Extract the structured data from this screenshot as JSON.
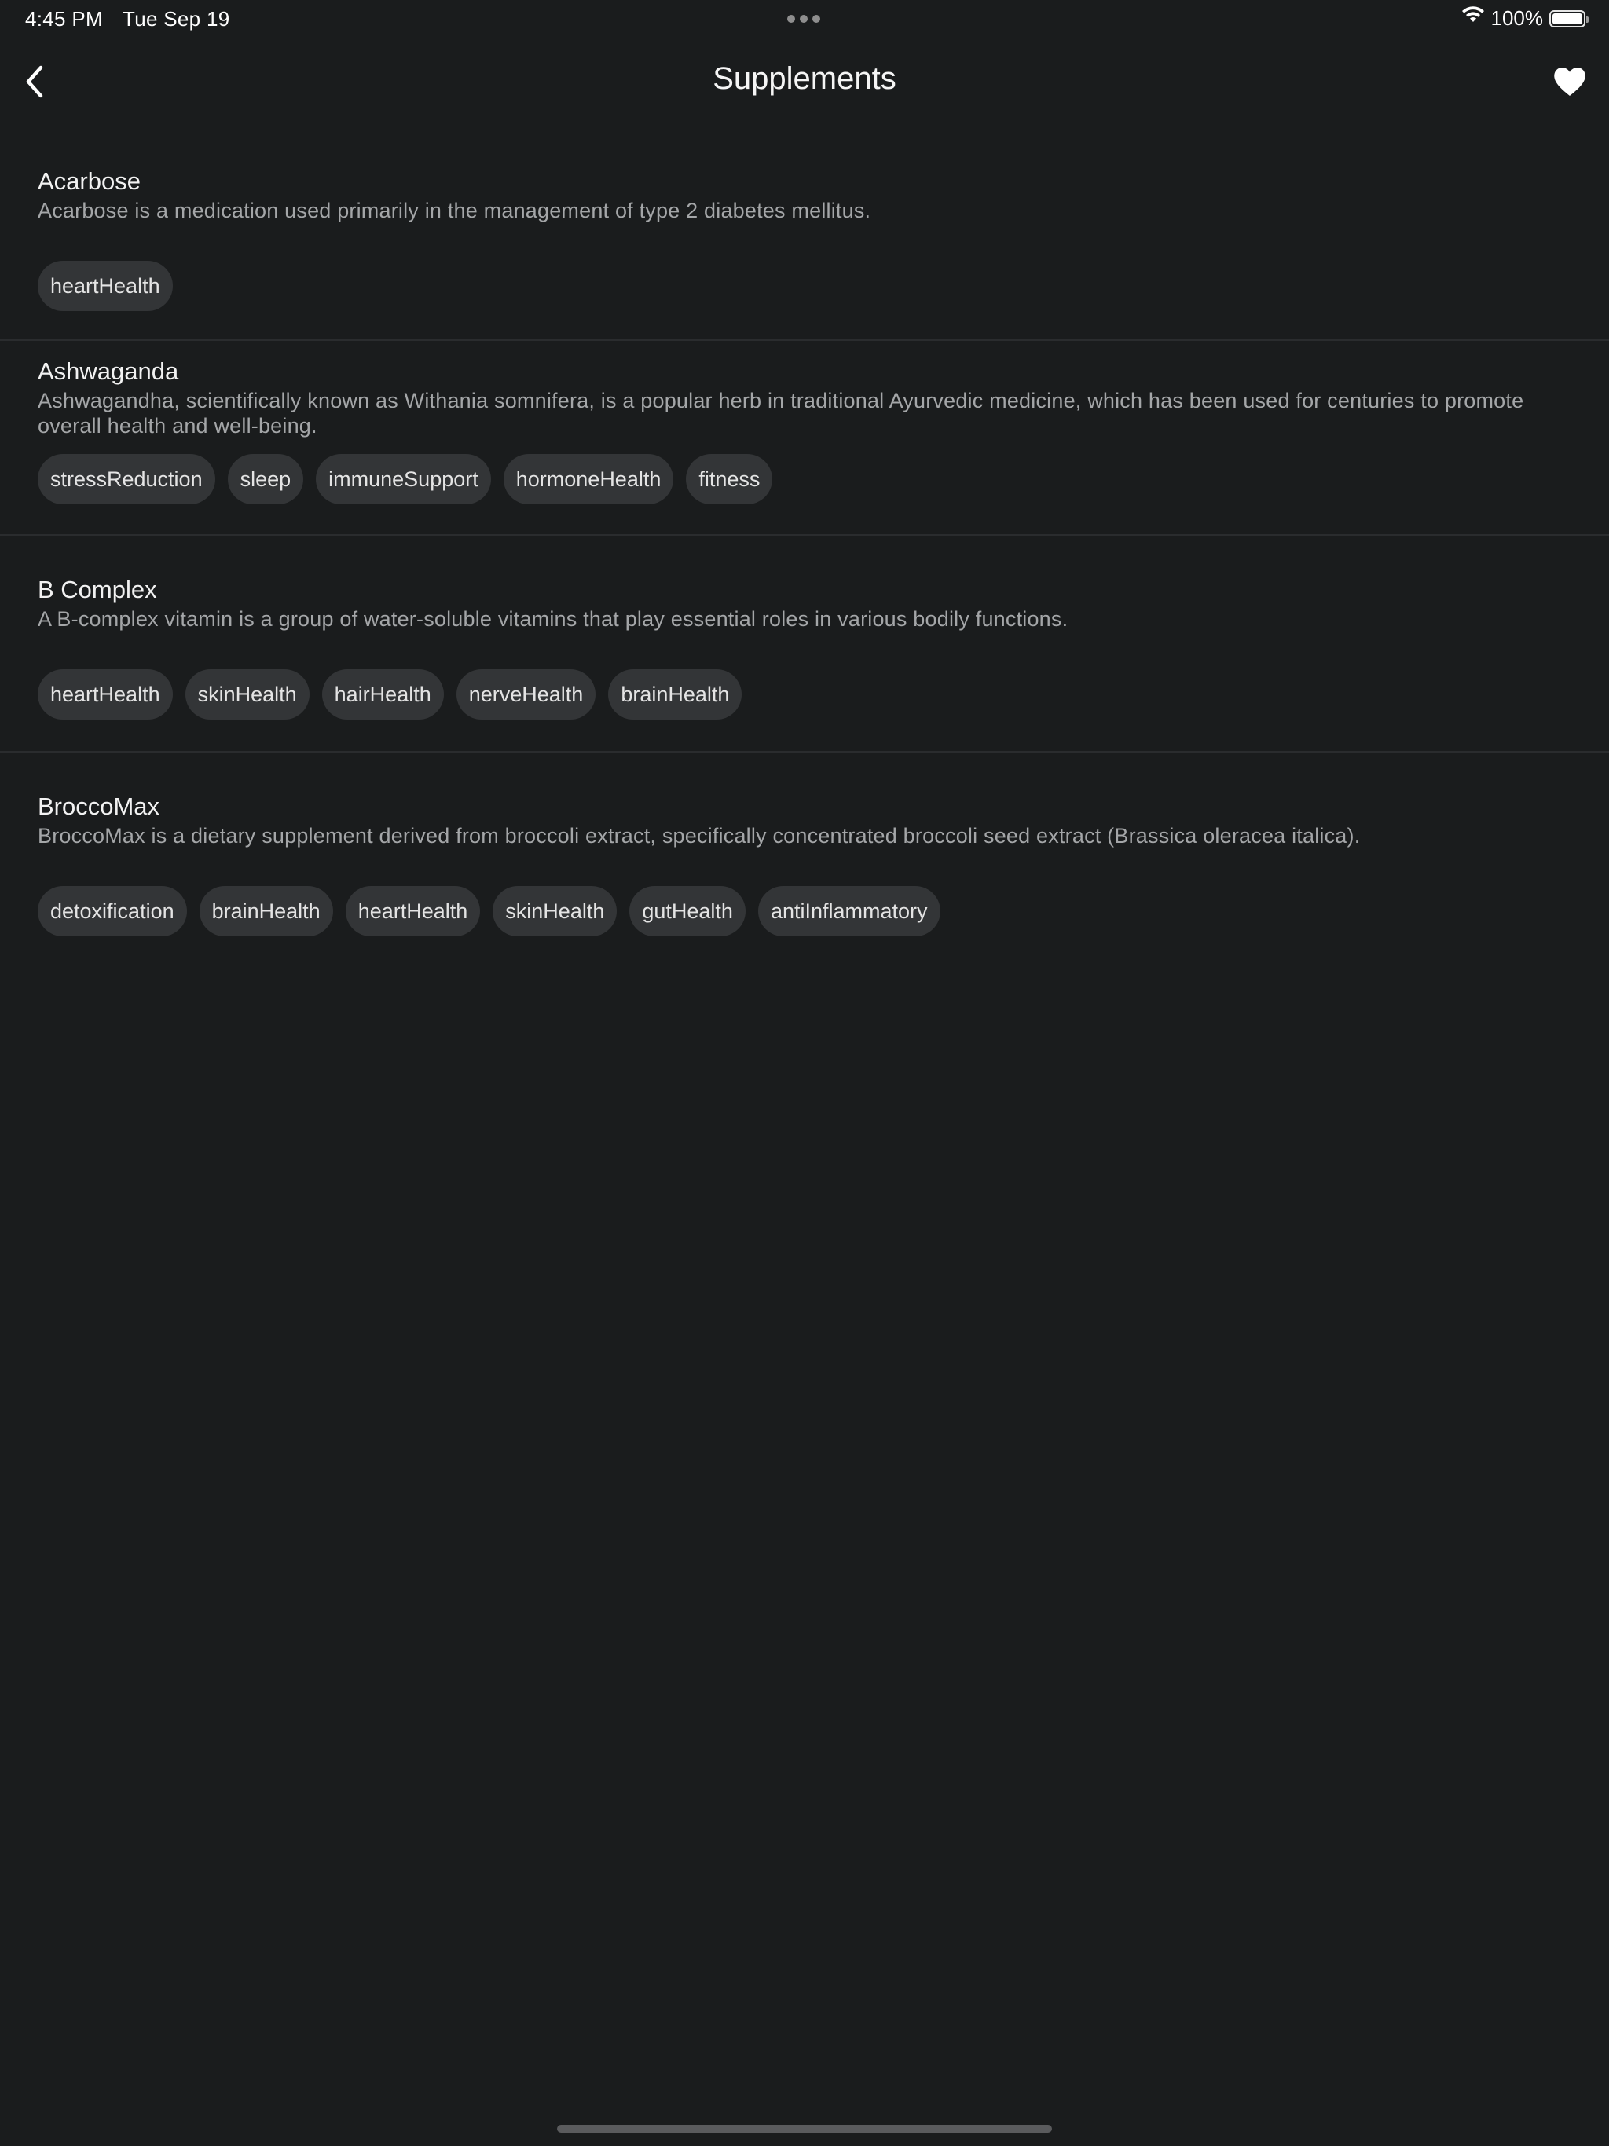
{
  "status_bar": {
    "time": "4:45 PM",
    "date": "Tue Sep 19",
    "battery_percent": "100%",
    "icons": [
      "wifi-icon",
      "battery-icon",
      "multitasking-dots-icon"
    ]
  },
  "nav": {
    "title": "Supplements",
    "back_icon": "chevron-left-icon",
    "favorite_icon": "heart-icon"
  },
  "colors": {
    "background": "#1a1c1d",
    "tag_background": "#333537",
    "primary_text": "#f2f2f2",
    "secondary_text": "#a4a6a8"
  },
  "supplements": [
    {
      "name": "Acarbose",
      "description": "Acarbose is a medication used primarily in the management of type 2 diabetes mellitus.",
      "tags": [
        "heartHealth"
      ]
    },
    {
      "name": "Ashwaganda",
      "description": "Ashwagandha, scientifically known as Withania somnifera, is a popular herb in traditional Ayurvedic medicine, which has been used for centuries to promote overall health and well-being.",
      "tags": [
        "stressReduction",
        "sleep",
        "immuneSupport",
        "hormoneHealth",
        "fitness"
      ]
    },
    {
      "name": "B Complex",
      "description": "A B-complex vitamin is a group of water-soluble vitamins that play essential roles in various bodily functions.",
      "tags": [
        "heartHealth",
        "skinHealth",
        "hairHealth",
        "nerveHealth",
        "brainHealth"
      ]
    },
    {
      "name": "BroccoMax",
      "description": "BroccoMax is a dietary supplement derived from broccoli extract, specifically concentrated broccoli seed extract (Brassica oleracea italica).",
      "tags": [
        "detoxification",
        "brainHealth",
        "heartHealth",
        "skinHealth",
        "gutHealth",
        "antiInflammatory"
      ]
    }
  ]
}
